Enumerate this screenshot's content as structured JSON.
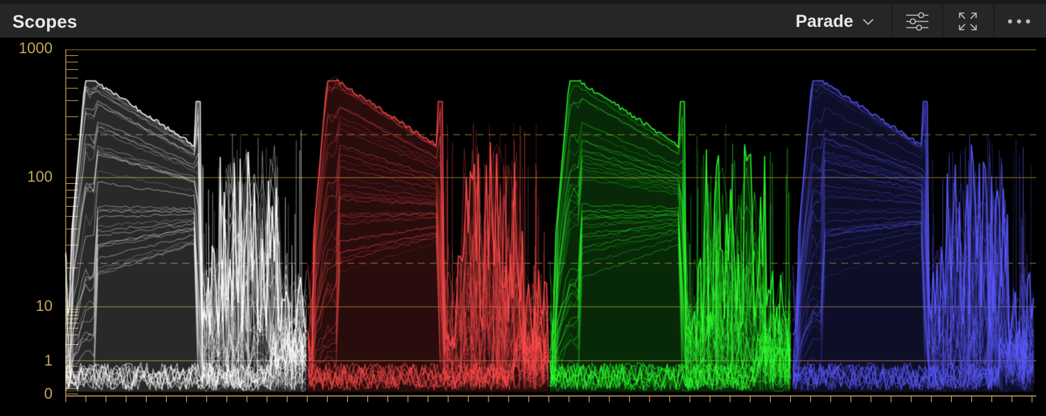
{
  "header": {
    "title": "Scopes",
    "mode": "Parade"
  },
  "icons": {
    "chevron": "chevron-down-icon",
    "settings": "sliders-icon",
    "fullscreen": "expand-icon",
    "more": "more-dots-icon"
  },
  "axis": {
    "ticks": [
      "1000",
      "100",
      "10",
      "1",
      "0"
    ]
  },
  "colors": {
    "header_bg": "#262626",
    "axis_gold": "#c9a35c",
    "grid_gold": "#7a5f28",
    "channel_luma": "#ffffff",
    "channel_red": "#ff4a4a",
    "channel_green": "#2cff2c",
    "channel_blue": "#5a5aff"
  },
  "channels": [
    {
      "name": "luma",
      "color": "#ffffff"
    },
    {
      "name": "red",
      "color": "#ff4a4a"
    },
    {
      "name": "green",
      "color": "#2cff2c"
    },
    {
      "name": "blue",
      "color": "#5a5aff"
    }
  ]
}
